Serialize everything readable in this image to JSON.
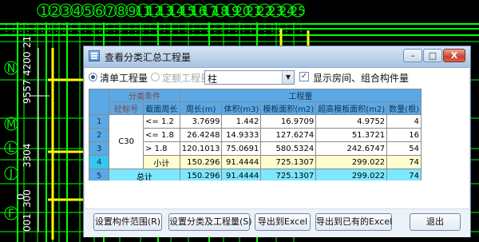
{
  "cad": {
    "top_ruler_numbers": [
      "1",
      "2",
      "3",
      "4",
      "5",
      "6",
      "7",
      "8",
      "9",
      "11",
      "12",
      "13",
      "14",
      "15",
      "16",
      "17",
      "18",
      "19",
      "20",
      "21",
      "22",
      "23",
      "24",
      "25"
    ],
    "left_axis_letters": [
      "N",
      "M",
      "L",
      "J",
      "F"
    ],
    "left_vertical_text": [
      "21",
      "9557",
      "4200",
      "3304",
      "0",
      "300",
      "001"
    ],
    "colors": {
      "background": "#000000",
      "grid_green": "#00ff00",
      "wall_yellow": "#ffff00",
      "annotation_white": "#ffffff"
    }
  },
  "dialog": {
    "title": "查看分类汇总工程量",
    "window_buttons": {
      "minimize": "–",
      "maximize": "□",
      "close": "X"
    },
    "options": {
      "list_quantity_label": "清单工程量",
      "quota_quantity_label": "定额工程量",
      "selected_option": "清单工程量",
      "component_type_value": "柱",
      "show_room_checkbox_label": "显示房间、组合构件量",
      "show_room_checked": true
    },
    "table": {
      "group_header": "分类条件",
      "quantity_group_header": "工程量",
      "columns": [
        "砼标号",
        "截面周长",
        "周长(m)",
        "体积(m3)",
        "模板面积(m2)",
        "超高模板面积(m2)",
        "数量(根)"
      ],
      "rows": [
        {
          "row_number": "1",
          "grade": "C30",
          "range": "<= 1.2",
          "perimeter": "3.7699",
          "volume": "1.442",
          "formwork_area": "16.9709",
          "high_formwork_area": "4.9752",
          "count": "4"
        },
        {
          "row_number": "2",
          "grade": "",
          "range": "<= 1.8",
          "perimeter": "26.4248",
          "volume": "14.9333",
          "formwork_area": "127.6274",
          "high_formwork_area": "51.3721",
          "count": "16"
        },
        {
          "row_number": "3",
          "grade": "",
          "range": "> 1.8",
          "perimeter": "120.1013",
          "volume": "75.0691",
          "formwork_area": "580.5324",
          "high_formwork_area": "242.6747",
          "count": "54"
        },
        {
          "row_number": "4",
          "grade": "",
          "range": "小计",
          "perimeter": "150.296",
          "volume": "91.4444",
          "formwork_area": "725.1307",
          "high_formwork_area": "299.022",
          "count": "74"
        },
        {
          "row_number": "5",
          "grade": "总计",
          "range": "",
          "perimeter": "150.296",
          "volume": "91.4444",
          "formwork_area": "725.1307",
          "high_formwork_area": "299.022",
          "count": "74"
        }
      ],
      "colors": {
        "header_blue": "#5aa9e6",
        "subtotal_yellow": "#fffccf",
        "total_cyan": "#7de7ff",
        "header_text_red": "#8c4040"
      }
    },
    "buttons": {
      "set_range": "设置构件范围(R)",
      "set_classification": "设置分类及工程量(S)",
      "export_excel": "导出到Excel",
      "export_existing_excel": "导出到已有的Excel",
      "exit": "退出"
    }
  }
}
